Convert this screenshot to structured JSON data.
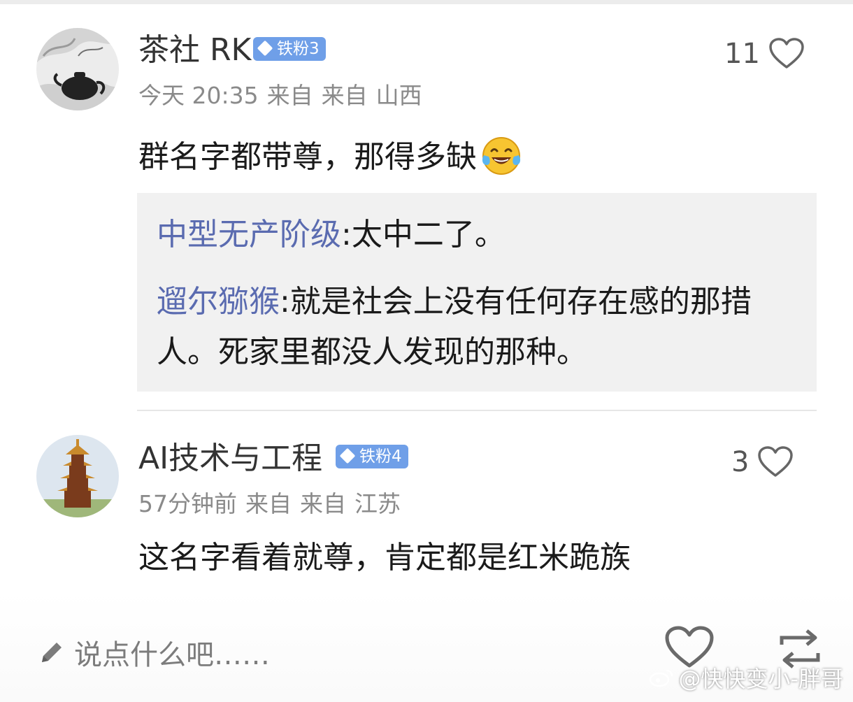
{
  "comments": [
    {
      "username": "茶社 RK",
      "badge": "铁粉3",
      "time": "今天 20:35",
      "from1": "来自",
      "from2": "来自",
      "location": "山西",
      "likes": "11",
      "text": "群名字都带尊，那得多缺",
      "emoji": "laughing-with-tears-emoji",
      "replies": [
        {
          "author": "中型无产阶级",
          "sep": ":",
          "text": "太中二了。"
        },
        {
          "author": "遛尔猕猴",
          "sep": ":",
          "text": "就是社会上没有任何存在感的那措人。死家里都没人发现的那种。"
        }
      ]
    },
    {
      "username": "AI技术与工程",
      "badge": "铁粉4",
      "time": "57分钟前",
      "from1": "来自",
      "from2": "来自",
      "location": "江苏",
      "likes": "3",
      "text": "这名字看着就尊，肯定都是红米跪族"
    }
  ],
  "footer": {
    "placeholder": "说点什么吧……",
    "icons": [
      "pencil-icon",
      "heart-icon",
      "repost-icon"
    ]
  },
  "watermark": "@快快变小-胖哥",
  "colors": {
    "badge": "#6f9fe8",
    "reply_author": "#5a6bb0",
    "meta": "#8a8a8a",
    "reply_bg": "#f1f1f1"
  }
}
